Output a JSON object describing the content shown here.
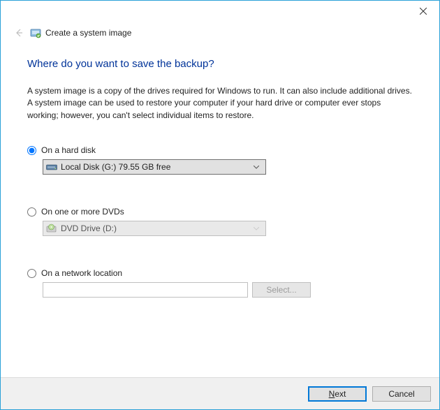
{
  "header": {
    "title": "Create a system image"
  },
  "heading": "Where do you want to save the backup?",
  "description": "A system image is a copy of the drives required for Windows to run. It can also include additional drives. A system image can be used to restore your computer if your hard drive or computer ever stops working; however, you can't select individual items to restore.",
  "options": {
    "hard_disk": {
      "label": "On a hard disk",
      "dropdown_value": "Local Disk (G:)  79.55 GB free",
      "selected": true
    },
    "dvd": {
      "label": "On one or more DVDs",
      "dropdown_value": "DVD Drive (D:)",
      "selected": false
    },
    "network": {
      "label": "On a network location",
      "input_value": "",
      "button_label": "Select...",
      "selected": false
    }
  },
  "footer": {
    "next_prefix": "N",
    "next_rest": "ext",
    "cancel_label": "Cancel"
  }
}
